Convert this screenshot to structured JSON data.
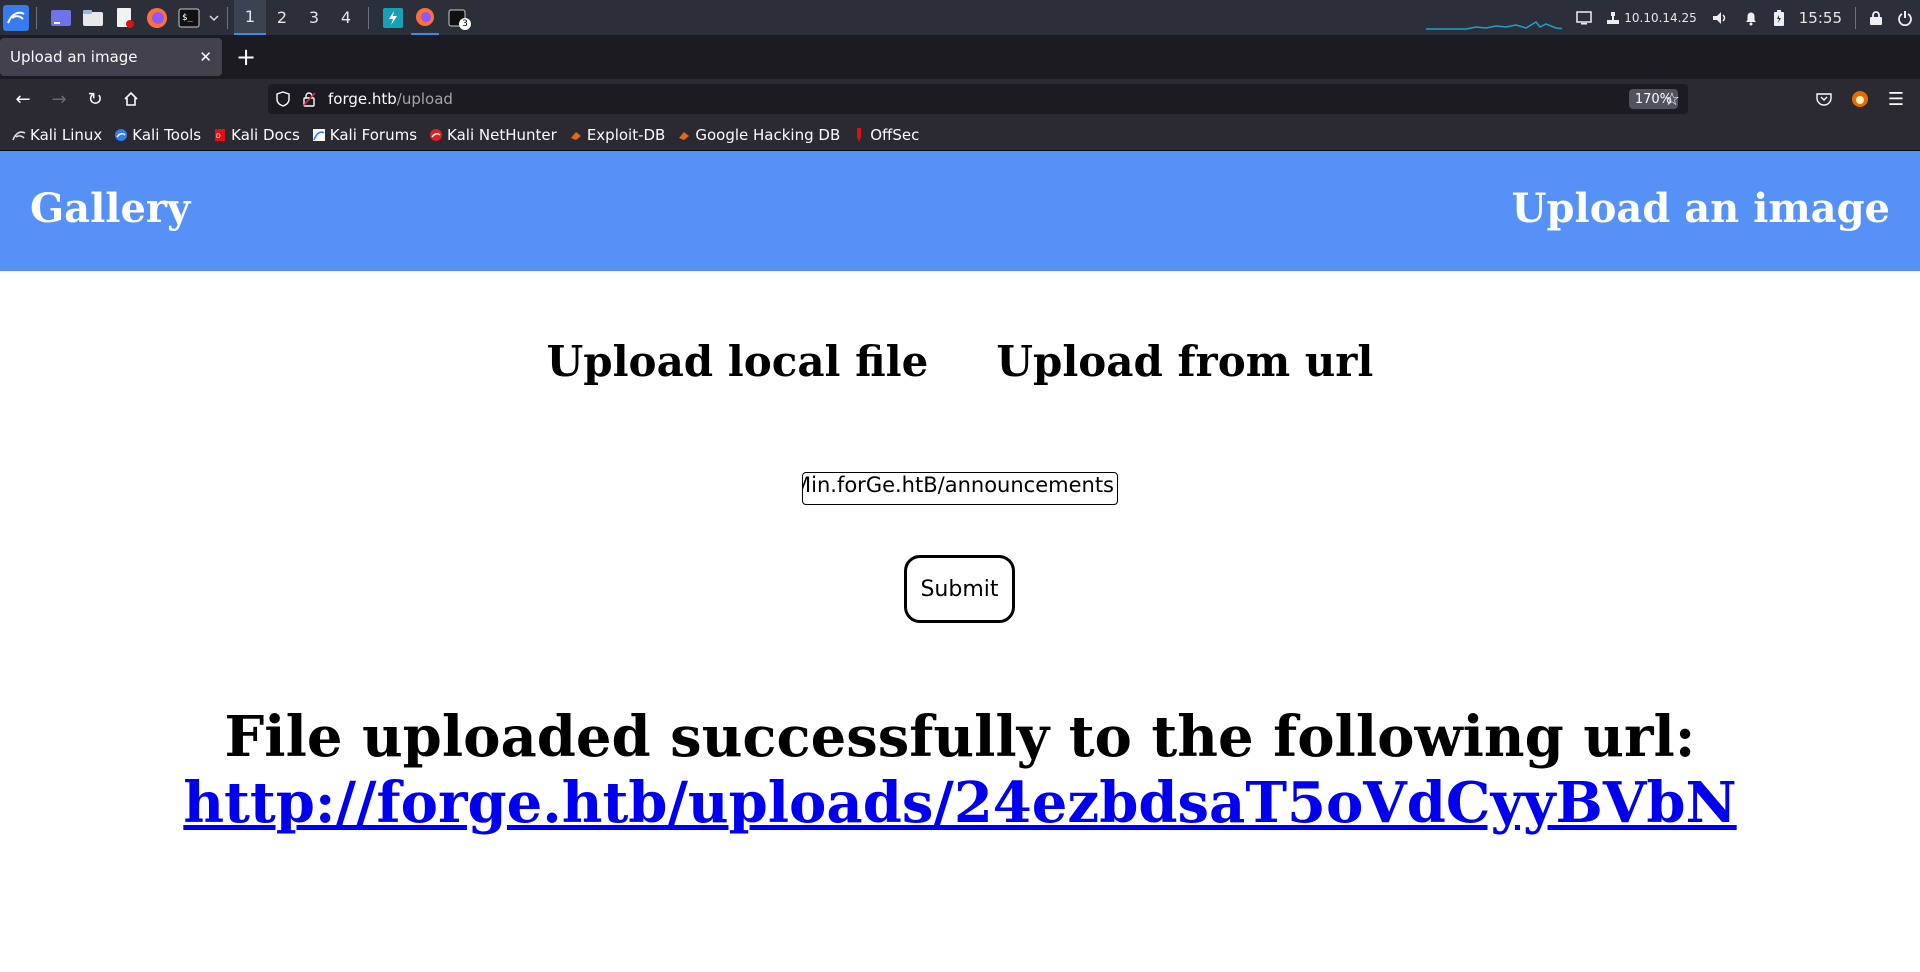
{
  "taskbar": {
    "workspaces": [
      "1",
      "2",
      "3",
      "4"
    ],
    "active_workspace": "1",
    "terminal_badge": "3",
    "ip": "10.10.14.25",
    "clock": "15:55"
  },
  "browser": {
    "tab_title": "Upload an image",
    "url_host": "forge.htb",
    "url_path": "/upload",
    "zoom": "170%",
    "bookmarks": [
      "Kali Linux",
      "Kali Tools",
      "Kali Docs",
      "Kali Forums",
      "Kali NetHunter",
      "Exploit-DB",
      "Google Hacking DB",
      "OffSec"
    ]
  },
  "site": {
    "brand": "Gallery",
    "nav_upload": "Upload an image",
    "tab_local": "Upload local file",
    "tab_url": "Upload from url",
    "url_field_value": "Min.forGe.htB/announcements",
    "submit_label": "Submit",
    "result_message": "File uploaded successfully to the following url:",
    "result_link": "http://forge.htb/uploads/24ezbdsaT5oVdCyyBVbN"
  },
  "colors": {
    "header_bg": "#5591f6",
    "link": "#0000ee"
  }
}
